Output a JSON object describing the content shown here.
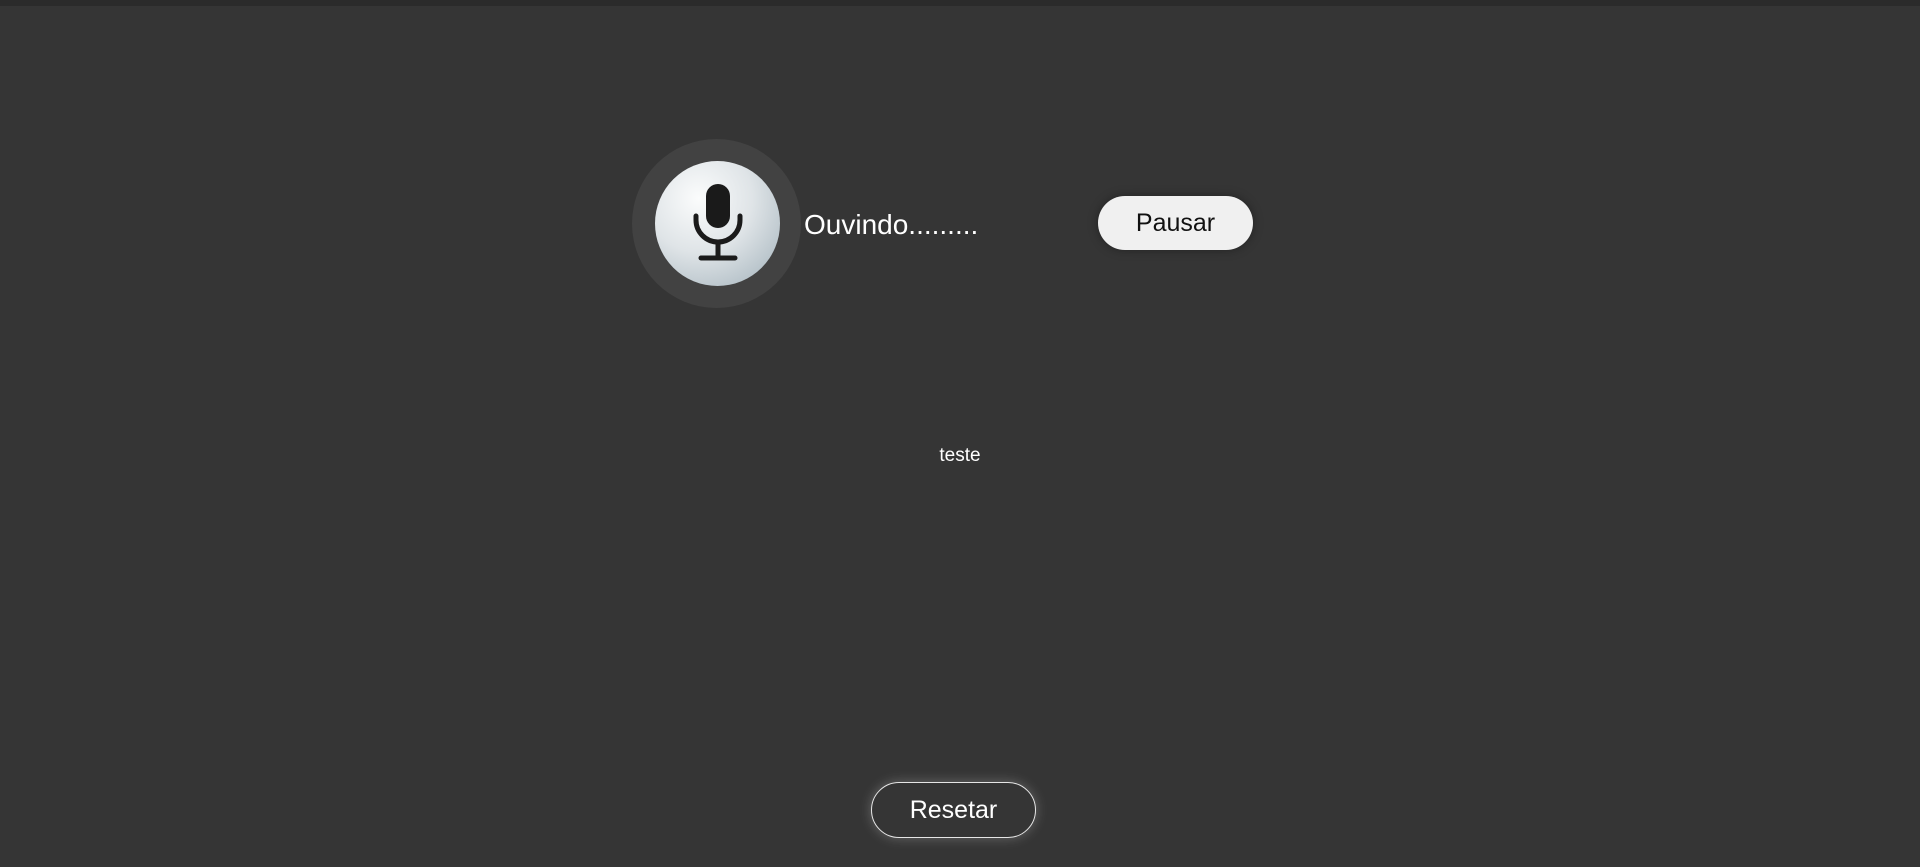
{
  "recorder": {
    "mic_icon": "microphone-icon",
    "status_text": "Ouvindo.........",
    "pause_label": "Pausar"
  },
  "transcript": {
    "text": "teste"
  },
  "controls": {
    "reset_label": "Resetar"
  },
  "colors": {
    "background": "#353535",
    "mic_ring": "#424242",
    "button_light": "#f0f0f0"
  }
}
